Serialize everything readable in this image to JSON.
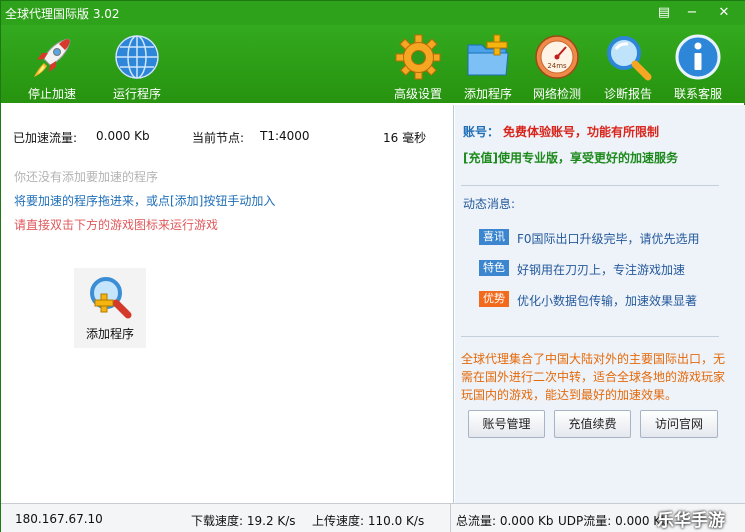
{
  "window": {
    "title": "全球代理国际版 3.02"
  },
  "toolbar": {
    "stop_accel": "停止加速",
    "run_program": "运行程序",
    "advanced": "高级设置",
    "add_program": "添加程序",
    "network_check": "网络检测",
    "diagnose": "诊断报告",
    "support": "联系客服",
    "gauge_text": "24ms"
  },
  "stats": {
    "accel_traffic_label": "已加速流量:",
    "accel_traffic_value": "0.000 Kb",
    "node_label": "当前节点:",
    "node_value": "T1:4000",
    "latency": "16 毫秒"
  },
  "hints": {
    "none_added": "你还没有添加要加速的程序",
    "drag_in": "将要加速的程序拖进来，或点[添加]按钮手动加入",
    "double_click": "请直接双击下方的游戏图标来运行游戏"
  },
  "add_program_tile": {
    "label": "添加程序"
  },
  "account": {
    "label": "账号：",
    "value": "免费体验账号，功能有所限制",
    "upgrade": "[充值]使用专业版，享受更好的加速服务"
  },
  "news": {
    "title": "动态消息:",
    "items": [
      {
        "tag": "喜讯",
        "text": "F0国际出口升级完毕，请优先选用",
        "color": "#3b86cf"
      },
      {
        "tag": "特色",
        "text": "好钢用在刀刃上，专注游戏加速",
        "color": "#3b86cf"
      },
      {
        "tag": "优势",
        "text": "优化小数据包传输，加速效果显著",
        "color": "#f26b1d"
      }
    ]
  },
  "description": "全球代理集合了中国大陆对外的主要国际出口，无需在国外进行二次中转，适合全球各地的游戏玩家玩国内的游戏，能达到最好的加速效果。",
  "buttons": {
    "account_manage": "账号管理",
    "recharge": "充值续费",
    "visit_site": "访问官网"
  },
  "status": {
    "ip": "180.167.67.10",
    "download": "下载速度: 19.2 K/s",
    "upload": "上传速度: 110.0 K/s",
    "total": "总流量: 0.000 Kb",
    "udp": "UDP流量: 0.000 Kb"
  },
  "watermark": "乐华手游"
}
